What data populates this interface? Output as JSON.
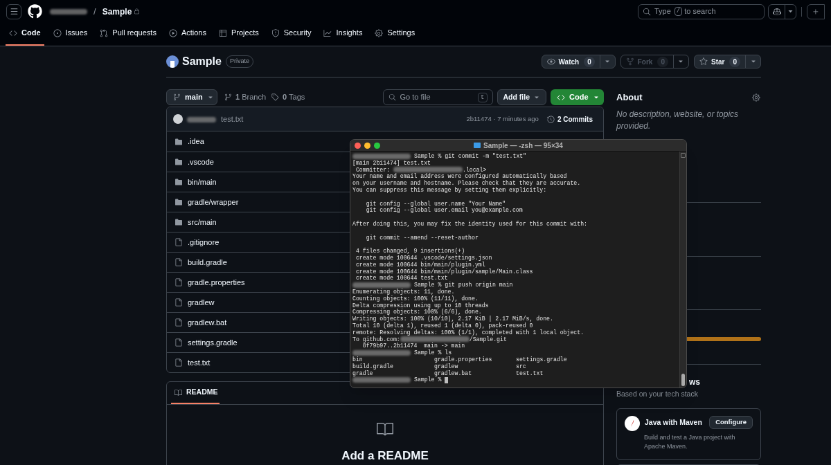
{
  "header": {
    "separator": "/",
    "repo_name": "Sample",
    "search": {
      "before": "Type",
      "key": "/",
      "after": "to search"
    }
  },
  "nav_tabs": [
    {
      "label": "Code",
      "selected": true
    },
    {
      "label": "Issues",
      "selected": false
    },
    {
      "label": "Pull requests",
      "selected": false
    },
    {
      "label": "Actions",
      "selected": false
    },
    {
      "label": "Projects",
      "selected": false
    },
    {
      "label": "Security",
      "selected": false
    },
    {
      "label": "Insights",
      "selected": false
    },
    {
      "label": "Settings",
      "selected": false
    }
  ],
  "repo": {
    "name": "Sample",
    "visibility": "Private",
    "actions": [
      {
        "label": "Watch",
        "count": "0",
        "disabled": false
      },
      {
        "label": "Fork",
        "count": "0",
        "disabled": true
      },
      {
        "label": "Star",
        "count": "0",
        "disabled": false
      }
    ]
  },
  "toolbar": {
    "branch": "main",
    "branches": "**1** Branch",
    "tags": "**0** Tags",
    "go_to_file": {
      "placeholder": "Go to file",
      "key": "t"
    },
    "add_file": "Add file",
    "code": "Code"
  },
  "latest_commit": {
    "message": "test.txt",
    "info": "2b11474 · 7 minutes ago",
    "commits": "2 Commits"
  },
  "files": [
    {
      "name": ".idea",
      "kind": "folder"
    },
    {
      "name": ".vscode",
      "kind": "folder"
    },
    {
      "name": "bin/main",
      "kind": "folder"
    },
    {
      "name": "gradle/wrapper",
      "kind": "folder"
    },
    {
      "name": "src/main",
      "kind": "folder"
    },
    {
      "name": ".gitignore",
      "kind": "file"
    },
    {
      "name": "build.gradle",
      "kind": "file"
    },
    {
      "name": "gradle.properties",
      "kind": "file"
    },
    {
      "name": "gradlew",
      "kind": "file"
    },
    {
      "name": "gradlew.bat",
      "kind": "file"
    },
    {
      "name": "settings.gradle",
      "kind": "file"
    },
    {
      "name": "test.txt",
      "kind": "file"
    }
  ],
  "readme": {
    "tab": "README",
    "title": "Add a README"
  },
  "about": {
    "title": "About",
    "description": "No description, website, or topics provided."
  },
  "workflows": {
    "title_visible": "ws",
    "subtitle": "Based on your tech stack",
    "cards": [
      {
        "title": "Java with Maven",
        "button": "Configure",
        "description": "Build and test a Java project with Apache Maven."
      }
    ]
  },
  "terminal": {
    "title": "Sample — -zsh — 95×34",
    "lines": [
      {
        "kind": "prompt",
        "text": "Sample % git commit -m \"test.txt\""
      },
      {
        "kind": "text",
        "text": "[main 2b11474] test.txt"
      },
      {
        "kind": "redacted",
        "before": " Committer: ",
        "after": ".local>"
      },
      {
        "kind": "text",
        "text": "Your name and email address were configured automatically based"
      },
      {
        "kind": "text",
        "text": "on your username and hostname. Please check that they are accurate."
      },
      {
        "kind": "text",
        "text": "You can suppress this message by setting them explicitly:"
      },
      {
        "kind": "blank"
      },
      {
        "kind": "text",
        "text": "    git config --global user.name \"Your Name\""
      },
      {
        "kind": "text",
        "text": "    git config --global user.email you@example.com"
      },
      {
        "kind": "blank"
      },
      {
        "kind": "text",
        "text": "After doing this, you may fix the identity used for this commit with:"
      },
      {
        "kind": "blank"
      },
      {
        "kind": "text",
        "text": "    git commit --amend --reset-author"
      },
      {
        "kind": "blank"
      },
      {
        "kind": "text",
        "text": " 4 files changed, 9 insertions(+)"
      },
      {
        "kind": "text",
        "text": " create mode 100644 .vscode/settings.json"
      },
      {
        "kind": "text",
        "text": " create mode 100644 bin/main/plugin.yml"
      },
      {
        "kind": "text",
        "text": " create mode 100644 bin/main/plugin/sample/Main.class"
      },
      {
        "kind": "text",
        "text": " create mode 100644 test.txt"
      },
      {
        "kind": "prompt",
        "text": "Sample % git push origin main"
      },
      {
        "kind": "text",
        "text": "Enumerating objects: 11, done."
      },
      {
        "kind": "text",
        "text": "Counting objects: 100% (11/11), done."
      },
      {
        "kind": "text",
        "text": "Delta compression using up to 10 threads"
      },
      {
        "kind": "text",
        "text": "Compressing objects: 100% (6/6), done."
      },
      {
        "kind": "text",
        "text": "Writing objects: 100% (10/10), 2.17 KiB | 2.17 MiB/s, done."
      },
      {
        "kind": "text",
        "text": "Total 10 (delta 1), reused 1 (delta 0), pack-reused 0"
      },
      {
        "kind": "text",
        "text": "remote: Resolving deltas: 100% (1/1), completed with 1 local object."
      },
      {
        "kind": "redacted",
        "before": "To github.com:",
        "after": "/Sample.git"
      },
      {
        "kind": "text",
        "text": "   8f79b97..2b11474  main -> main"
      },
      {
        "kind": "prompt",
        "text": "Sample % ls"
      },
      {
        "kind": "columns",
        "cells": [
          "bin",
          "gradle.properties",
          "settings.gradle"
        ]
      },
      {
        "kind": "columns",
        "cells": [
          "build.gradle",
          "gradlew",
          "src"
        ]
      },
      {
        "kind": "columns",
        "cells": [
          "gradle",
          "gradlew.bat",
          "test.txt"
        ]
      },
      {
        "kind": "prompt",
        "text": "Sample %",
        "cursor": true
      }
    ]
  }
}
